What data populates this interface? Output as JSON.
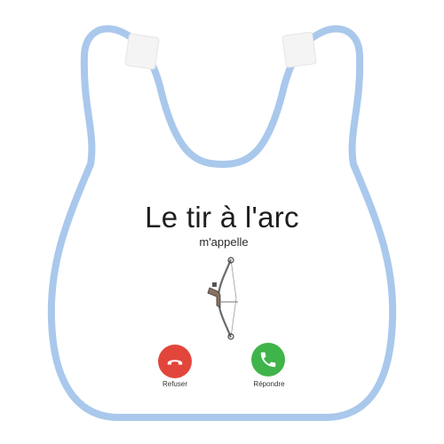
{
  "bib": {
    "body_color": "#ffffff",
    "trim_color": "#a9c8ec",
    "tab_color": "#f4f4f4"
  },
  "print": {
    "title": "Le tir à l'arc",
    "subtitle": "m'appelle",
    "illustration": "compound-bow-icon"
  },
  "call": {
    "decline": {
      "label": "Refuser",
      "icon": "phone-hangup-icon",
      "color": "#e2463b"
    },
    "accept": {
      "label": "Répondre",
      "icon": "phone-icon",
      "color": "#3fb44a"
    }
  }
}
